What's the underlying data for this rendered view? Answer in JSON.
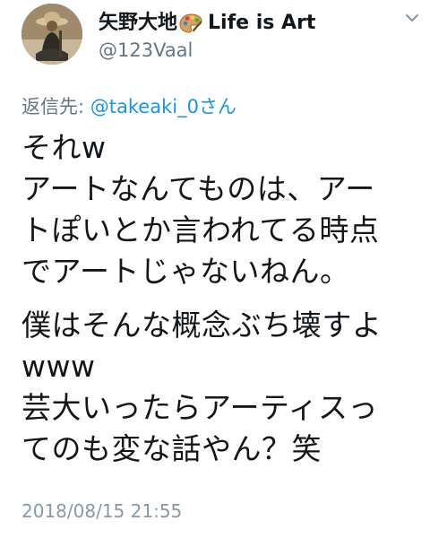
{
  "user": {
    "display_name": "矢野大地",
    "display_name_suffix": "Life is Art",
    "handle": "@123Vaal",
    "avatar_icon": "avatar-photo",
    "badge_icon": "artist-palette-icon"
  },
  "reply": {
    "prefix": "返信先: ",
    "mention": "@takeaki_0さん"
  },
  "tweet": {
    "lines_block1": [
      "それw",
      "アートなんてものは、アー",
      "トぽいとか言われてる時点",
      "でアートじゃないねん。"
    ],
    "lines_block2": [
      "僕はそんな概念ぶち壊すよ",
      "www",
      "芸大いったらアーティスっ",
      "てのも変な話やん？笑"
    ]
  },
  "timestamp": "2018/08/15 21:55",
  "colors": {
    "text": "#14171a",
    "secondary": "#657786",
    "link": "#1b95e0",
    "timestamp": "#8899a6"
  }
}
